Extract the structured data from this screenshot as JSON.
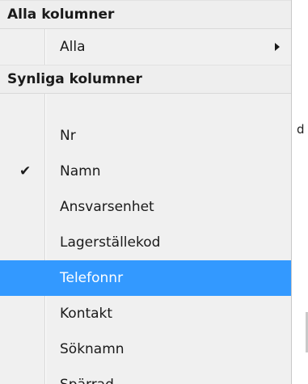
{
  "menu": {
    "sections": [
      {
        "header": "Alla kolumner",
        "items": [
          {
            "label": "Alla",
            "checked": false,
            "submenu": true,
            "selected": false
          }
        ]
      },
      {
        "header": "Synliga kolumner",
        "items": [
          {
            "label": "Nr",
            "checked": false,
            "selected": false
          },
          {
            "label": "Namn",
            "checked": true,
            "selected": false
          },
          {
            "label": "Ansvarsenhet",
            "checked": false,
            "selected": false
          },
          {
            "label": "Lagerställekod",
            "checked": false,
            "selected": false
          },
          {
            "label": "Telefonnr",
            "checked": false,
            "selected": true
          },
          {
            "label": "Kontakt",
            "checked": false,
            "selected": false
          },
          {
            "label": "Söknamn",
            "checked": false,
            "selected": false
          },
          {
            "label": "Spärrad",
            "checked": false,
            "selected": false
          }
        ]
      }
    ],
    "check_glyph": "✔",
    "colors": {
      "menu_background": "#f0f0f0",
      "highlight": "#3399ff",
      "highlight_text": "#ffffff"
    }
  },
  "background": {
    "fragment_text": "d"
  }
}
